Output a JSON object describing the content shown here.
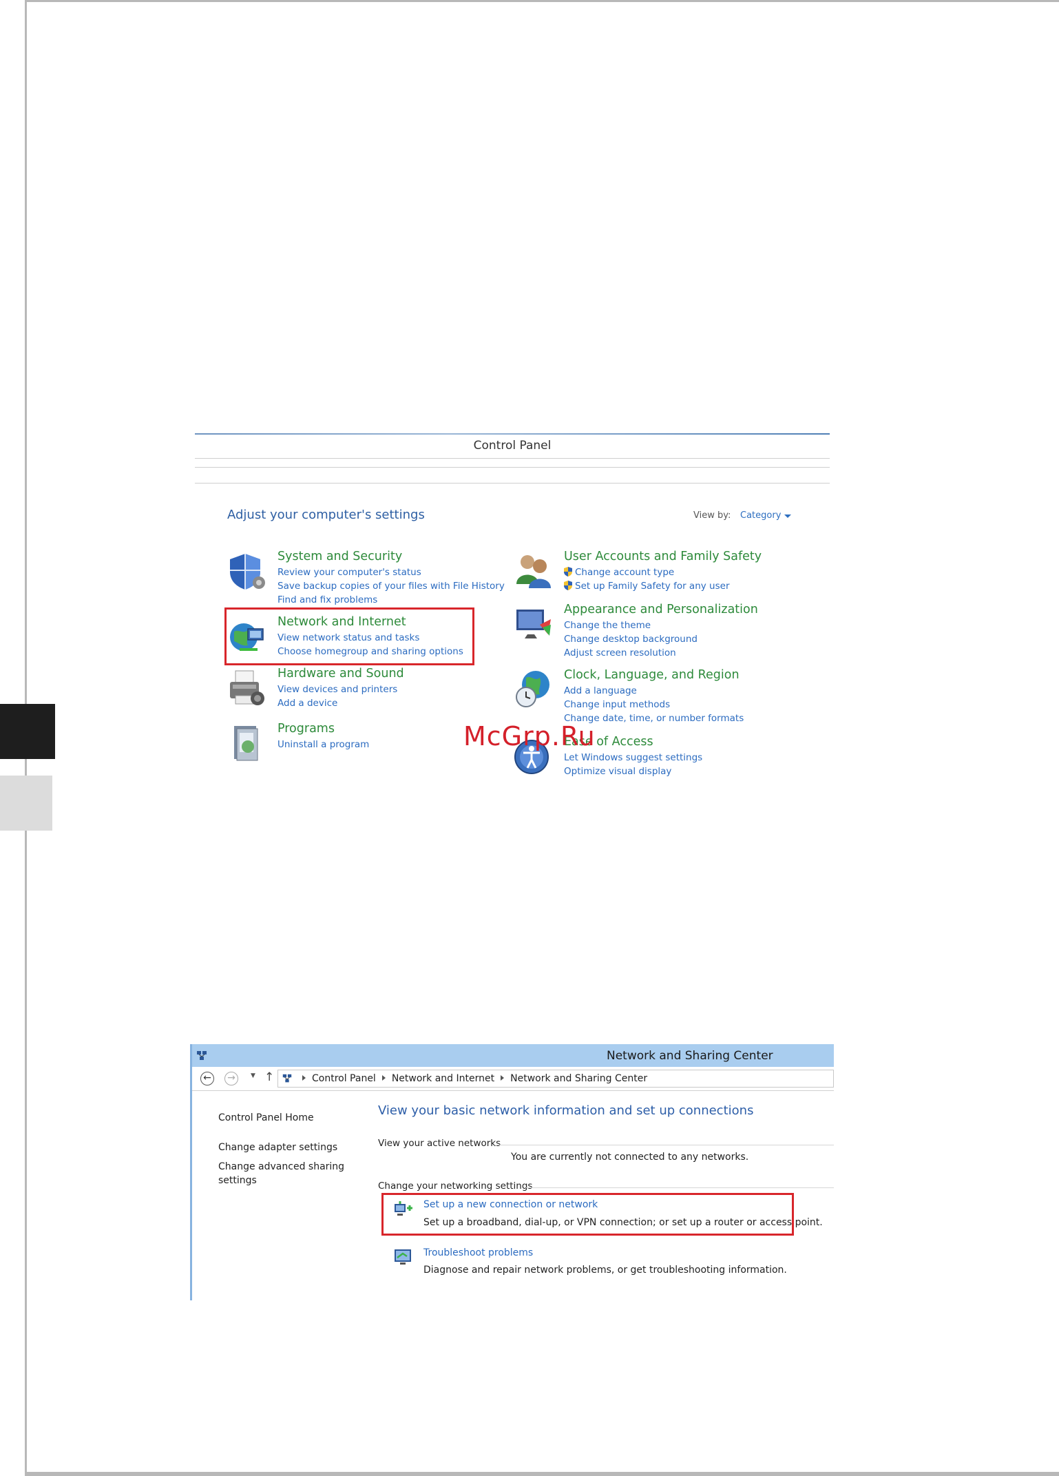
{
  "control_panel": {
    "window_title": "Control Panel",
    "heading": "Adjust your computer's settings",
    "view_by_label": "View by:",
    "view_by_value": "Category",
    "categories": [
      {
        "title": "System and Security",
        "icon": "shield-icon",
        "links": [
          "Review your computer's status",
          "Save backup copies of your files with File History",
          "Find and fix problems"
        ]
      },
      {
        "title": "Network and Internet",
        "icon": "globe-network-icon",
        "links": [
          "View network status and tasks",
          "Choose homegroup and sharing options"
        ]
      },
      {
        "title": "Hardware and Sound",
        "icon": "printer-icon",
        "links": [
          "View devices and printers",
          "Add a device"
        ]
      },
      {
        "title": "Programs",
        "icon": "programs-icon",
        "links": [
          "Uninstall a program"
        ]
      },
      {
        "title": "User Accounts and Family Safety",
        "icon": "users-icon",
        "links": [
          "Change account type",
          "Set up Family Safety for any user"
        ]
      },
      {
        "title": "Appearance and Personalization",
        "icon": "monitor-icon",
        "links": [
          "Change the theme",
          "Change desktop background",
          "Adjust screen resolution"
        ]
      },
      {
        "title": "Clock, Language, and Region",
        "icon": "clock-globe-icon",
        "links": [
          "Add a language",
          "Change input methods",
          "Change date, time, or number formats"
        ]
      },
      {
        "title": "Ease of Access",
        "icon": "ease-of-access-icon",
        "links": [
          "Let Windows suggest settings",
          "Optimize visual display"
        ]
      }
    ],
    "highlight_color": "#d8262b"
  },
  "watermark": "McGrp.Ru",
  "network_center": {
    "window_title": "Network and Sharing Center",
    "breadcrumbs": [
      "Control Panel",
      "Network and Internet",
      "Network and Sharing Center"
    ],
    "sidebar": {
      "home": "Control Panel Home",
      "adapter": "Change adapter settings",
      "advanced_line1": "Change advanced sharing",
      "advanced_line2": "settings"
    },
    "main_title": "View your basic network information and set up connections",
    "active_networks_label": "View your active networks",
    "not_connected": "You are currently not connected to any networks.",
    "change_settings_label": "Change your networking settings",
    "tasks": [
      {
        "link": "Set up a new connection or network",
        "desc": "Set up a broadband, dial-up, or VPN connection; or set up a router or access point.",
        "icon": "new-connection-icon"
      },
      {
        "link": "Troubleshoot problems",
        "desc": "Diagnose and repair network problems, or get troubleshooting information.",
        "icon": "troubleshoot-icon"
      }
    ],
    "titlebar_color": "#a9cdef"
  }
}
